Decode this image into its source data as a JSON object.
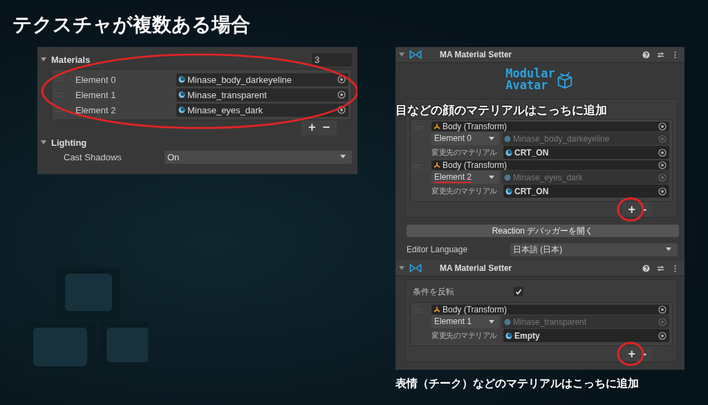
{
  "title": "テクスチャが複数ある場合",
  "renderer_panel": {
    "materials": {
      "label": "Materials",
      "expanded": true,
      "count": "3",
      "elements": [
        {
          "label": "Element 0",
          "value": "Minase_body_darkeyeline"
        },
        {
          "label": "Element 1",
          "value": "Minase_transparent"
        },
        {
          "label": "Element 2",
          "value": "Minase_eyes_dark"
        }
      ],
      "add": "+",
      "remove": "−"
    },
    "lighting": {
      "label": "Lighting",
      "expanded": true,
      "rows": [
        {
          "label": "Cast Shadows",
          "value": "On"
        }
      ]
    }
  },
  "setter_1": {
    "title": "MA Material Setter",
    "expanded": true,
    "logo": {
      "line1": "Modular",
      "line2": "Avatar"
    },
    "entries": [
      {
        "object": "Body (Transform)",
        "slot": "Element 0",
        "current": "Minase_body_darkeyeline",
        "target_label": "変更先のマテリアル",
        "target": "CRT_ON",
        "underlined": false
      },
      {
        "object": "Body (Transform)",
        "slot": "Element 2",
        "current": "Minase_eyes_dark",
        "target_label": "変更先のマテリアル",
        "target": "CRT_ON",
        "underlined": true
      }
    ],
    "add": "+",
    "remove": "-"
  },
  "reaction_button": "Reaction デバッガーを開く",
  "editor_language": {
    "label": "Editor Language",
    "value": "日本語 (日本)"
  },
  "setter_2": {
    "title": "MA Material Setter",
    "expanded": true,
    "invert": {
      "label": "条件を反転",
      "checked": true
    },
    "entries": [
      {
        "object": "Body (Transform)",
        "slot": "Element 1",
        "current": "Minase_transparent",
        "target_label": "変更先のマテリアル",
        "target": "Empty",
        "underlined": false
      }
    ],
    "add": "+",
    "remove": "-"
  },
  "caption_1": "目などの顔のマテリアルはこっちに追加",
  "caption_2": "表情（チーク）などのマテリアルはこっちに追加"
}
